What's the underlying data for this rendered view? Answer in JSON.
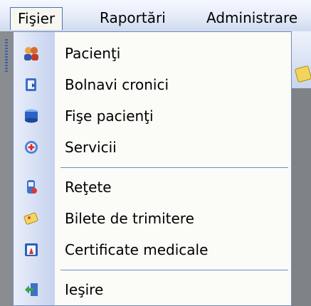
{
  "menubar": {
    "items": [
      {
        "label": "Fişier",
        "active": true
      },
      {
        "label": "Raportări"
      },
      {
        "label": "Administrare"
      }
    ]
  },
  "dropdown": {
    "items": [
      {
        "label": "Pacienţi",
        "icon": "patients-icon"
      },
      {
        "label": "Bolnavi cronici",
        "icon": "chronic-patients-icon"
      },
      {
        "label": "Fişe pacienţi",
        "icon": "patient-files-icon"
      },
      {
        "label": "Servicii",
        "icon": "services-icon"
      },
      {
        "label": "Reţete",
        "icon": "prescriptions-icon"
      },
      {
        "label": "Bilete de trimitere",
        "icon": "referral-tickets-icon"
      },
      {
        "label": "Certificate medicale",
        "icon": "medical-certificates-icon"
      },
      {
        "label": "Ieşire",
        "icon": "exit-icon"
      }
    ]
  }
}
